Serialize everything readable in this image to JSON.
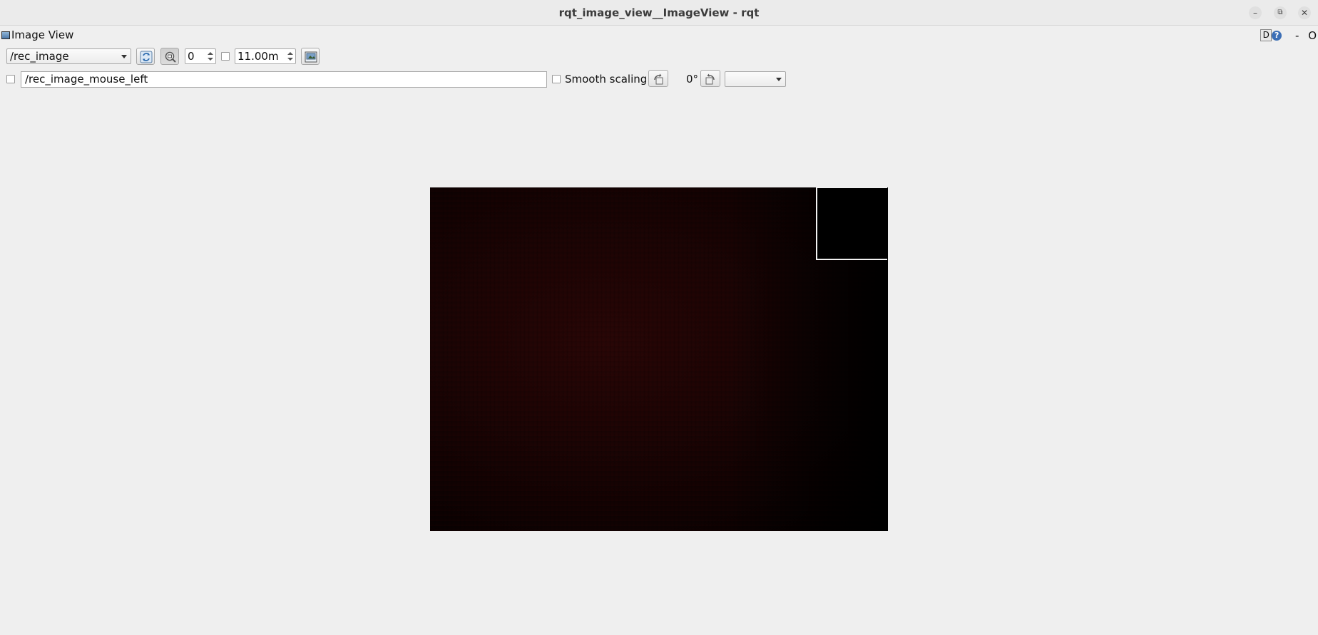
{
  "window": {
    "title": "rqt_image_view__ImageView - rqt",
    "minimize_glyph": "–",
    "restore_glyph": "⧉",
    "close_glyph": "✕"
  },
  "dock": {
    "title": "Image View",
    "right_d": "D",
    "right_help": "?",
    "right_dash": "-",
    "right_o": "O"
  },
  "toolbar": {
    "topic_selected": "/rec_image",
    "refresh_icon": "refresh-icon",
    "zoom_icon": "zoom-fit-icon",
    "num_gridlines": "0",
    "max_range_checked": false,
    "max_range_value": "11.00m",
    "save_icon": "save-icon"
  },
  "second_row": {
    "publish_checked": false,
    "mouse_topic": "/rec_image_mouse_left",
    "smooth_scaling_checked": false,
    "smooth_scaling_label": "Smooth scaling",
    "rotate_left_icon": "rotate-left-icon",
    "rotation_label": "0°",
    "rotate_right_icon": "rotate-right-icon",
    "color_scheme_selected": ""
  },
  "colors": {
    "background": "#efefef",
    "image_dark_red": "#2a0606",
    "inset_border": "#f2f2f2"
  }
}
